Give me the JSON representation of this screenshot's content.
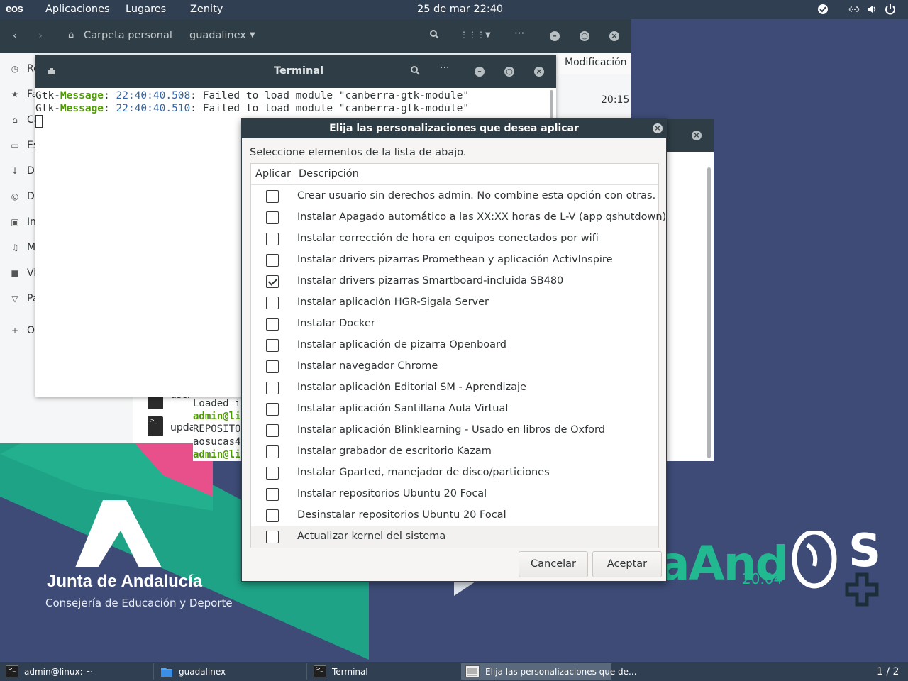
{
  "topbar": {
    "logo": "eos",
    "menus": [
      "Aplicaciones",
      "Lugares",
      "Zenity"
    ],
    "clock": "25 de mar  22:40",
    "tray_icons": [
      "check-circle-icon",
      "network-icon",
      "volume-icon",
      "power-icon"
    ]
  },
  "files": {
    "breadcrumb": {
      "home": "Carpeta personal",
      "current": "guadalinex"
    },
    "sidebar": [
      "Re",
      "Fa",
      "Ca",
      "Es",
      "De",
      "De",
      "Im",
      "M",
      "Vi",
      "Pa",
      "O"
    ],
    "column_header": "Modificación",
    "time_value": "20:15",
    "content_items": [
      {
        "name": "uscr"
      },
      {
        "name": "upda"
      }
    ]
  },
  "terminal_back": {
    "lines": [
      "Loaded i",
      "admin@li",
      "REPOSITO",
      "aosucas4",
      "admin@li"
    ]
  },
  "terminal": {
    "title": "Terminal",
    "lines": [
      {
        "prefix": "Gtk-",
        "tag": "Message",
        "sep": ": ",
        "time": "22:40:40.508",
        "msg": ": Failed to load module \"canberra-gtk-module\""
      },
      {
        "prefix": "Gtk-",
        "tag": "Message",
        "sep": ": ",
        "time": "22:40:40.510",
        "msg": ": Failed to load module \"canberra-gtk-module\""
      }
    ]
  },
  "dialog": {
    "title": "Elija las personalizaciones que desea aplicar",
    "prompt": "Seleccione elementos de la lista de abajo.",
    "columns": {
      "apply": "Aplicar",
      "description": "Descripción"
    },
    "items": [
      {
        "label": "Crear usuario sin derechos admin. No combine esta opción con otras.",
        "checked": false
      },
      {
        "label": "Instalar Apagado automático a las XX:XX horas de L-V (app qshutdown)",
        "checked": false
      },
      {
        "label": "Instalar corrección de hora en equipos conectados por wifi",
        "checked": false
      },
      {
        "label": "Instalar drivers pizarras Promethean y aplicación ActivInspire",
        "checked": false
      },
      {
        "label": "Instalar drivers pizarras Smartboard-incluida SB480",
        "checked": true
      },
      {
        "label": "Instalar aplicación HGR-Sigala Server",
        "checked": false
      },
      {
        "label": "Instalar Docker",
        "checked": false
      },
      {
        "label": "Instalar aplicación de pizarra Openboard",
        "checked": false
      },
      {
        "label": "Instalar navegador Chrome",
        "checked": false
      },
      {
        "label": "Instalar aplicación Editorial SM - Aprendizaje",
        "checked": false
      },
      {
        "label": "Instalar aplicación Santillana Aula Virtual",
        "checked": false
      },
      {
        "label": "Instalar aplicación Blinklearning - Usado en libros de Oxford",
        "checked": false
      },
      {
        "label": "Instalar grabador de escritorio Kazam",
        "checked": false
      },
      {
        "label": "Instalar Gparted, manejador de disco/particiones",
        "checked": false
      },
      {
        "label": "Instalar repositorios Ubuntu 20 Focal",
        "checked": false
      },
      {
        "label": "Desinstalar repositorios Ubuntu 20 Focal",
        "checked": false
      },
      {
        "label": "Actualizar kernel del sistema",
        "checked": false
      }
    ],
    "buttons": {
      "cancel": "Cancelar",
      "accept": "Aceptar"
    }
  },
  "wallpaper": {
    "junta_title": "Junta de Andalucía",
    "junta_subtitle": "Consejería de Educación y Deporte",
    "andos_text": "aAnd",
    "andos_suffix": "S",
    "andos_version": "20.04"
  },
  "taskbar": {
    "tasks": [
      {
        "label": "admin@linux: ~",
        "icon": "terminal-icon"
      },
      {
        "label": "guadalinex",
        "icon": "folder-icon"
      },
      {
        "label": "Terminal",
        "icon": "terminal-icon"
      },
      {
        "label": "Elija las personalizaciones que de...",
        "icon": "list-window-icon",
        "active": true
      }
    ],
    "workspace": "1 / 2"
  },
  "colors": {
    "panel": "#303f52",
    "headerbar": "#2f3e46",
    "desktop": "#3d4b76",
    "accent_green": "#22b890",
    "accent_pink": "#e84e8a",
    "terminal_green": "#4e9a06",
    "terminal_blue": "#3465a4"
  }
}
